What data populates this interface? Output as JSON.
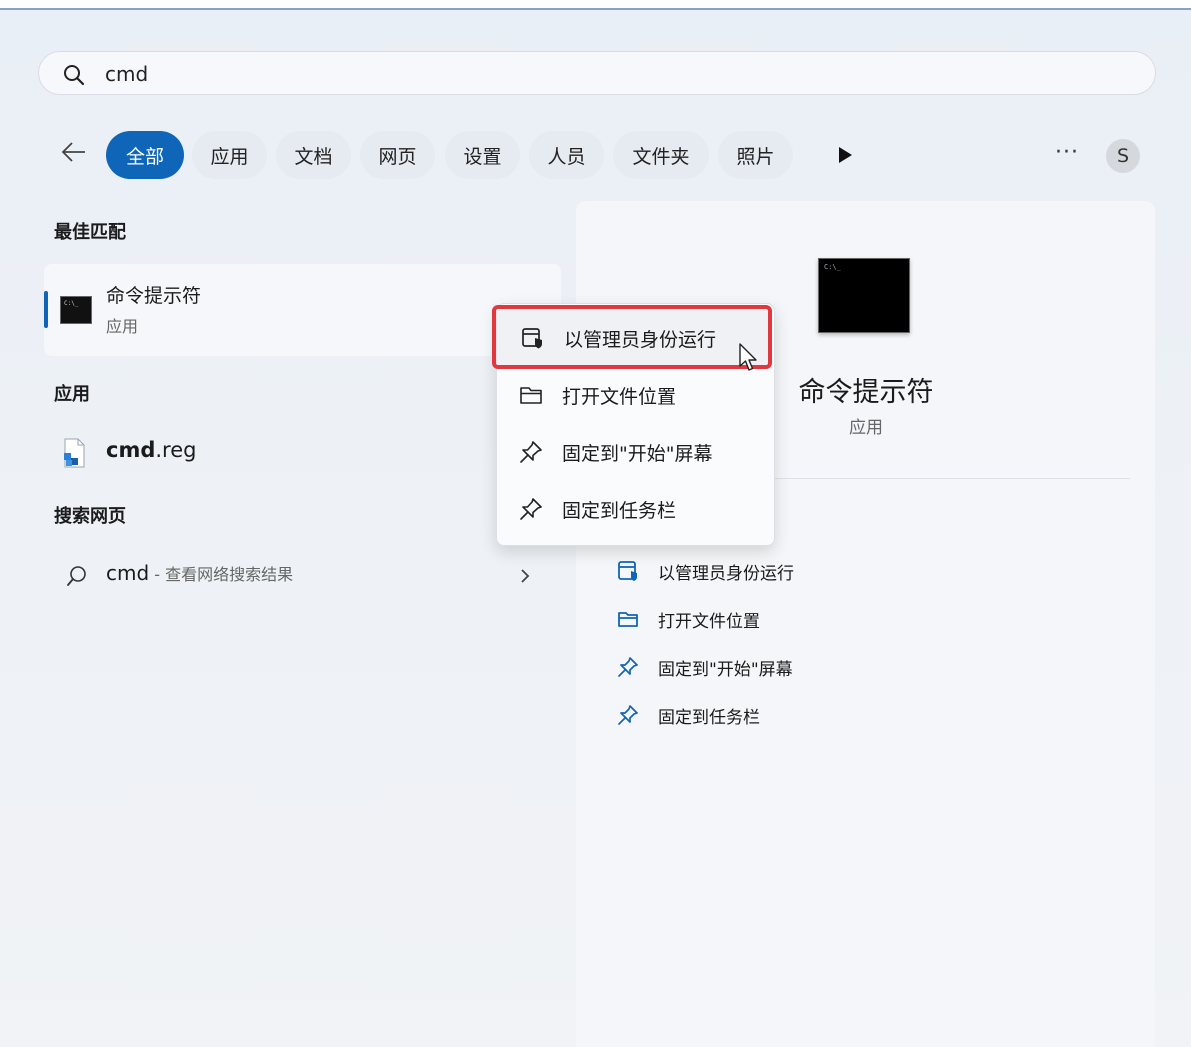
{
  "search": {
    "query": "cmd"
  },
  "filters": {
    "items": [
      {
        "label": "全部",
        "active": true
      },
      {
        "label": "应用"
      },
      {
        "label": "文档"
      },
      {
        "label": "网页"
      },
      {
        "label": "设置"
      },
      {
        "label": "人员"
      },
      {
        "label": "文件夹"
      },
      {
        "label": "照片"
      }
    ],
    "more_label": "···",
    "avatar_initial": "S"
  },
  "results": {
    "best_match": {
      "heading": "最佳匹配",
      "title": "命令提示符",
      "subtitle": "应用"
    },
    "apps": {
      "heading": "应用",
      "item_bold": "cmd",
      "item_rest": ".reg"
    },
    "web": {
      "heading": "搜索网页",
      "query": "cmd",
      "hint": " - 查看网络搜索结果"
    }
  },
  "context_menu": {
    "items": [
      {
        "label": "以管理员身份运行",
        "icon": "shield-app-icon"
      },
      {
        "label": "打开文件位置",
        "icon": "folder-icon"
      },
      {
        "label": "固定到\"开始\"屏幕",
        "icon": "pin-icon"
      },
      {
        "label": "固定到任务栏",
        "icon": "pin-icon"
      }
    ]
  },
  "preview": {
    "title": "命令提示符",
    "subtitle": "应用",
    "actions": [
      {
        "label": "以管理员身份运行",
        "icon": "shield-app-icon"
      },
      {
        "label": "打开文件位置",
        "icon": "folder-icon"
      },
      {
        "label": "固定到\"开始\"屏幕",
        "icon": "pin-icon"
      },
      {
        "label": "固定到任务栏",
        "icon": "pin-icon"
      }
    ]
  },
  "colors": {
    "accent": "#0f65b8",
    "highlight_border": "#e0383e"
  }
}
